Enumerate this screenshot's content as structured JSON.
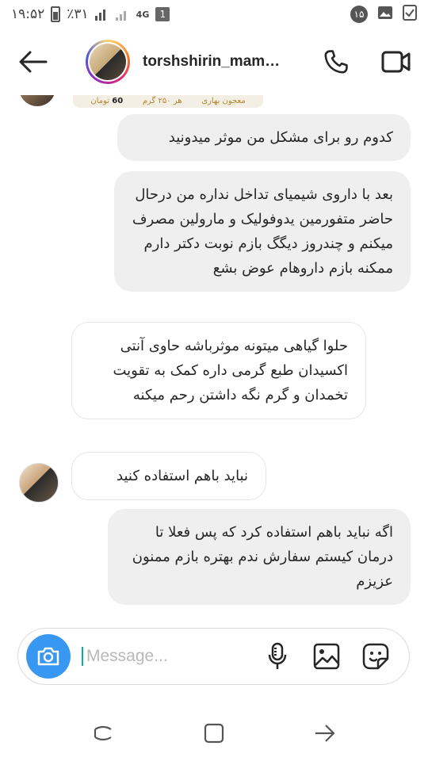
{
  "status_bar": {
    "time": "۱۹:۵۲",
    "battery_percent": "٪۳۱",
    "network": "4G",
    "sim_slot": "1",
    "notification_count": "۱۵"
  },
  "header": {
    "username": "torshshirin_mam…",
    "icons": [
      "back-arrow-icon",
      "phone-icon",
      "video-camera-icon"
    ]
  },
  "shared_post_strip": {
    "product_name": "معجون بهاری",
    "weight": "هر ۲۵۰ گرم",
    "price_value": "60",
    "currency": "تومان"
  },
  "messages": [
    {
      "type": "sent",
      "text": "کدوم رو برای مشکل من موثر میدونید"
    },
    {
      "type": "sent",
      "text": "بعد با داروی شیمیای تداخل نداره من درحال حاضر متفورمین یدوفولیک و مارولین مصرف میکنم و چندروز دیگگ بازم نوبت دکتر دارم ممکنه بازم داروهام عوض بشع"
    },
    {
      "type": "received",
      "text": "حلوا گیاهی میتونه موثرباشه حاوی آنتی اکسیدان طبع گرمی داره کمک به تقویت تخمدان و گرم نگه داشتن رحم میکنه"
    },
    {
      "type": "received",
      "text": "نباید باهم استفاده کنید"
    },
    {
      "type": "sent",
      "text": "اگه نباید باهم استفاده کرد که پس فعلا تا درمان کیستم سفارش ندم بهتره بازم ممنون عزیزم"
    }
  ],
  "composer": {
    "placeholder": "Message...",
    "icons": [
      "camera-icon",
      "microphone-icon",
      "gallery-icon",
      "sticker-icon"
    ]
  },
  "colors": {
    "accent_blue": "#3897f0",
    "bubble_gray": "#efefef",
    "border_gray": "#dbdbdb"
  }
}
